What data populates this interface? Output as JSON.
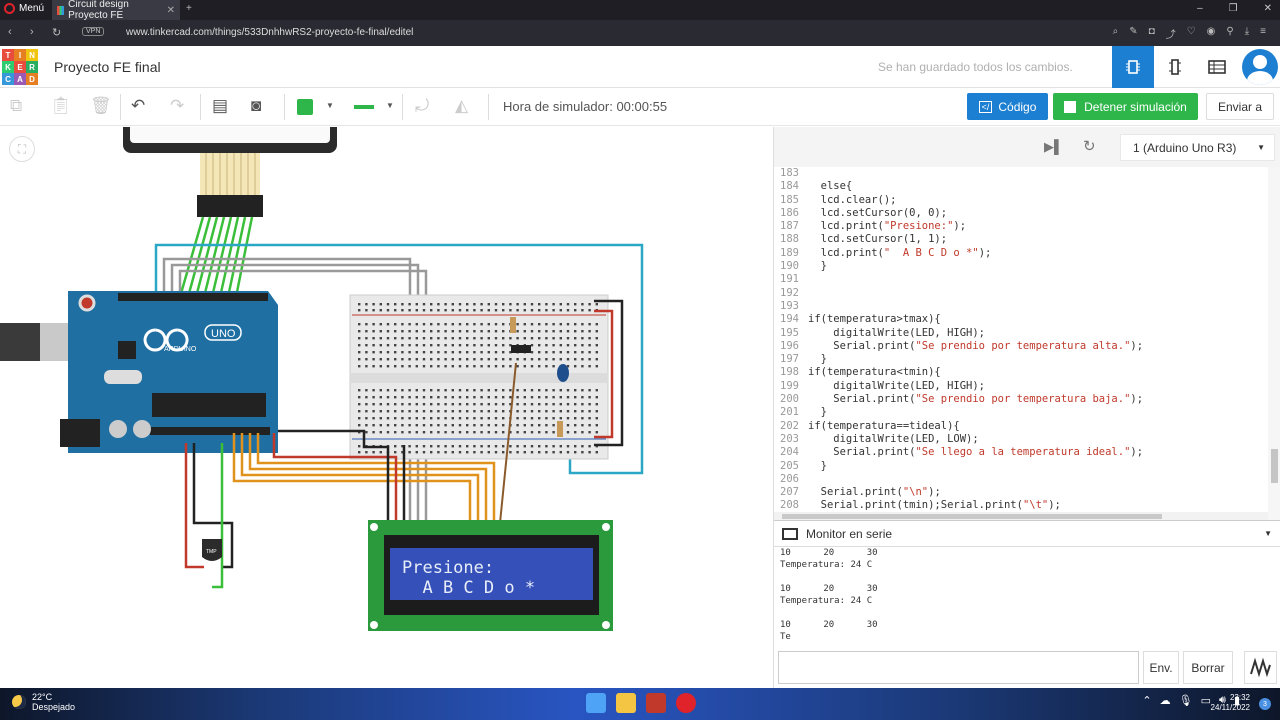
{
  "browser": {
    "menu_label": "Menú",
    "tab_title": "Circuit design Proyecto FE",
    "url": "www.tinkercad.com/things/533DnhhwRS2-proyecto-fe-final/editel",
    "vpn": "VPN"
  },
  "header": {
    "logo_letters": [
      "TIN",
      "KER",
      "CAD"
    ],
    "project_title": "Proyecto FE final",
    "save_status": "Se han guardado todos los cambios."
  },
  "toolbar": {
    "sim_time": "Hora de simulador: 00:00:55",
    "code_label": "Código",
    "stop_label": "Detener simulación",
    "send_label": "Enviar a"
  },
  "colors": {
    "accent_blue": "#1d7fd1",
    "sim_green": "#2fb64b",
    "arduino_blue": "#1f6fa3",
    "lcd_blue": "#3550b8"
  },
  "canvas": {
    "lcd_line1": "Presione:",
    "lcd_line2": "  A B C D o *",
    "arduino_brand": "ARDUINO",
    "arduino_model": "UNO",
    "tmp_label": "TMP"
  },
  "code_panel": {
    "device": "1 (Arduino Uno R3)",
    "lines": [
      {
        "n": "183",
        "t": ""
      },
      {
        "n": "184",
        "t": "  else{"
      },
      {
        "n": "185",
        "t": "  lcd.clear();"
      },
      {
        "n": "186",
        "t": "  lcd.setCursor(0, 0);"
      },
      {
        "n": "187",
        "t": "  lcd.print(\"Presione:\");"
      },
      {
        "n": "188",
        "t": "  lcd.setCursor(1, 1);"
      },
      {
        "n": "189",
        "t": "  lcd.print(\"  A B C D o *\");"
      },
      {
        "n": "190",
        "t": "  }"
      },
      {
        "n": "191",
        "t": ""
      },
      {
        "n": "192",
        "t": ""
      },
      {
        "n": "193",
        "t": ""
      },
      {
        "n": "194",
        "t": "if(temperatura>tmax){"
      },
      {
        "n": "195",
        "t": "    digitalWrite(LED, HIGH);"
      },
      {
        "n": "196",
        "t": "    Serial.print(\"Se prendio por temperatura alta.\");"
      },
      {
        "n": "197",
        "t": "  }"
      },
      {
        "n": "198",
        "t": "if(temperatura<tmin){"
      },
      {
        "n": "199",
        "t": "    digitalWrite(LED, HIGH);"
      },
      {
        "n": "200",
        "t": "    Serial.print(\"Se prendio por temperatura baja.\");"
      },
      {
        "n": "201",
        "t": "  }"
      },
      {
        "n": "202",
        "t": "if(temperatura==tideal){"
      },
      {
        "n": "203",
        "t": "    digitalWrite(LED, LOW);"
      },
      {
        "n": "204",
        "t": "    Serial.print(\"Se llego a la temperatura ideal.\");"
      },
      {
        "n": "205",
        "t": "  }"
      },
      {
        "n": "206",
        "t": ""
      },
      {
        "n": "207",
        "t": "  Serial.print(\"\\n\");"
      },
      {
        "n": "208",
        "t": "  Serial.print(tmin);Serial.print(\"\\t\");"
      },
      {
        "n": "209",
        "t": ""
      }
    ],
    "serial_title": "Monitor en serie",
    "serial_output": "10      20      30\nTemperatura: 24 C\n\n10      20      30\nTemperatura: 24 C\n\n10      20      30\nTe",
    "send_btn": "Env.",
    "clear_btn": "Borrar"
  },
  "taskbar": {
    "temp": "22°C",
    "weather": "Despejado",
    "time": "23:32",
    "date": "24/11/2022",
    "notifications": "3"
  }
}
